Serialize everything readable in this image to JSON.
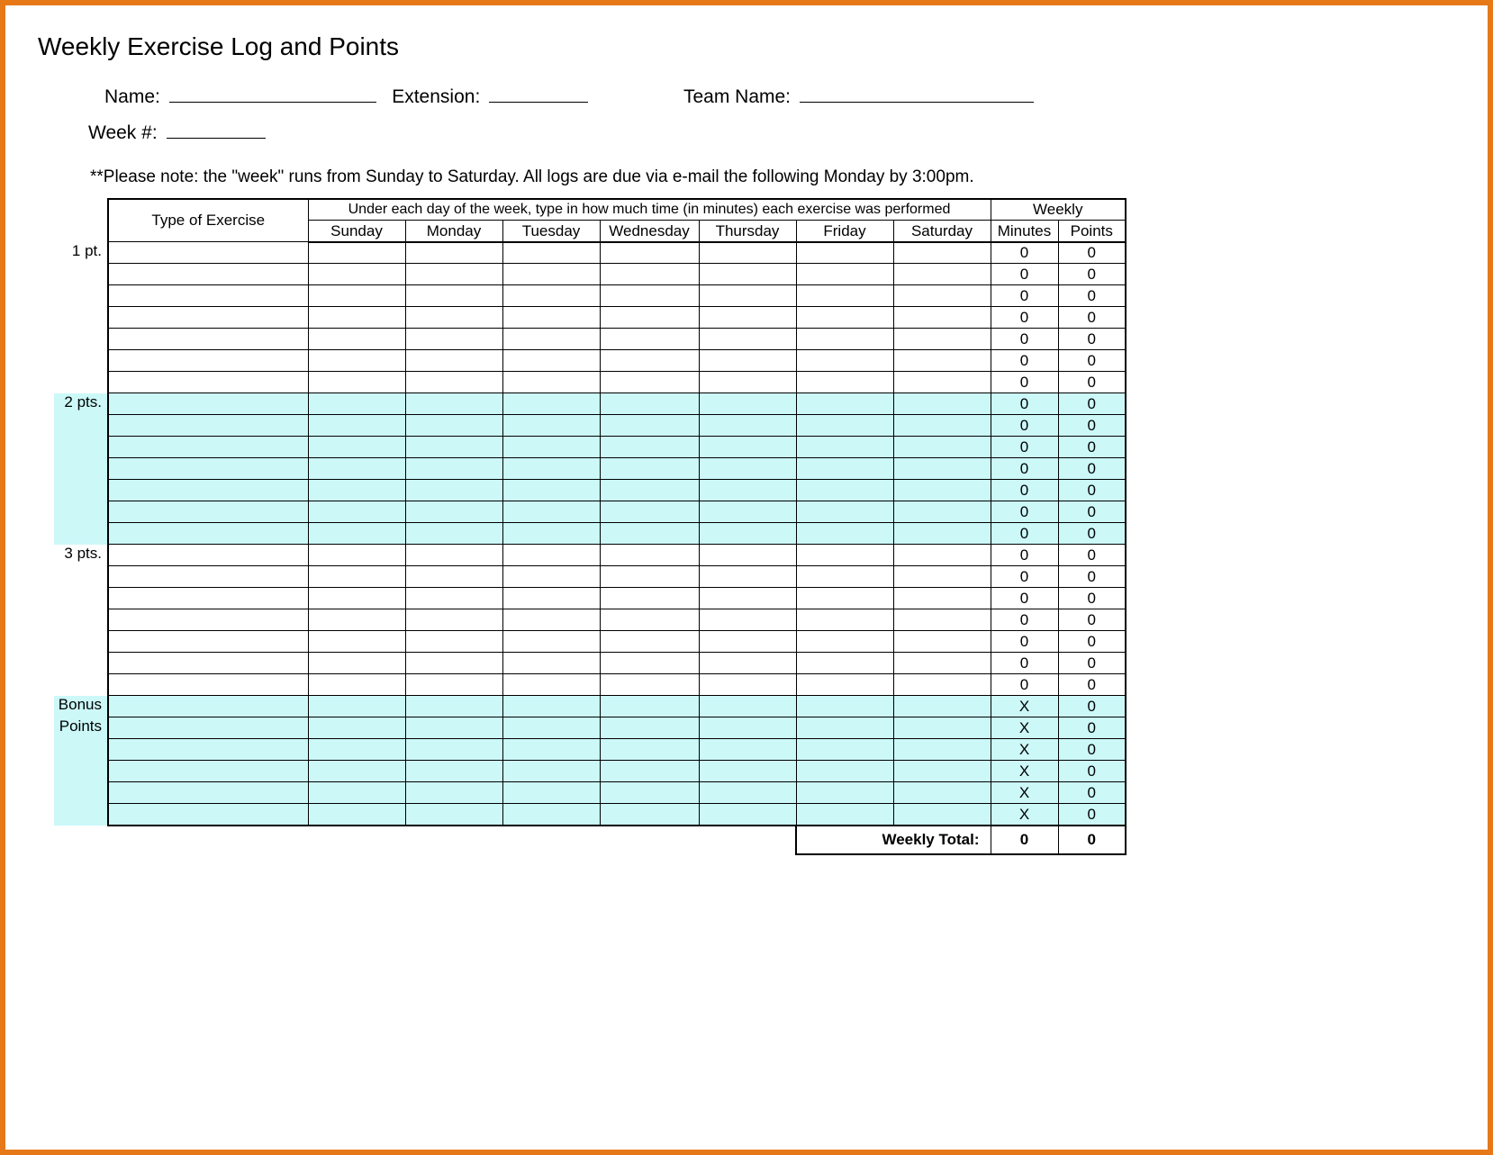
{
  "title": "Weekly Exercise Log and Points",
  "meta": {
    "name_label": "Name:",
    "extension_label": "Extension:",
    "team_label": "Team Name:",
    "week_label": "Week #:"
  },
  "note": "**Please note: the \"week\" runs from Sunday to Saturday.  All logs are due via e-mail the following Monday by 3:00pm.",
  "table": {
    "type_header": "Type of Exercise",
    "instruction": "Under each day of the week, type in how much time (in minutes) each exercise was performed",
    "weekly_header": "Weekly",
    "days": [
      "Sunday",
      "Monday",
      "Tuesday",
      "Wednesday",
      "Thursday",
      "Friday",
      "Saturday"
    ],
    "wk_cols": [
      "Minutes",
      "Points"
    ],
    "sections": [
      {
        "label": "1 pt.",
        "shaded": false,
        "rows": 7,
        "minutes": "0",
        "points": "0"
      },
      {
        "label": "2 pts.",
        "shaded": true,
        "rows": 7,
        "minutes": "0",
        "points": "0"
      },
      {
        "label": "3 pts.",
        "shaded": false,
        "rows": 7,
        "minutes": "0",
        "points": "0"
      },
      {
        "label": "Bonus",
        "label2": "Points",
        "shaded": true,
        "rows": 6,
        "minutes": "X",
        "points": "0"
      }
    ],
    "total_label": "Weekly Total:",
    "total_minutes": "0",
    "total_points": "0"
  }
}
